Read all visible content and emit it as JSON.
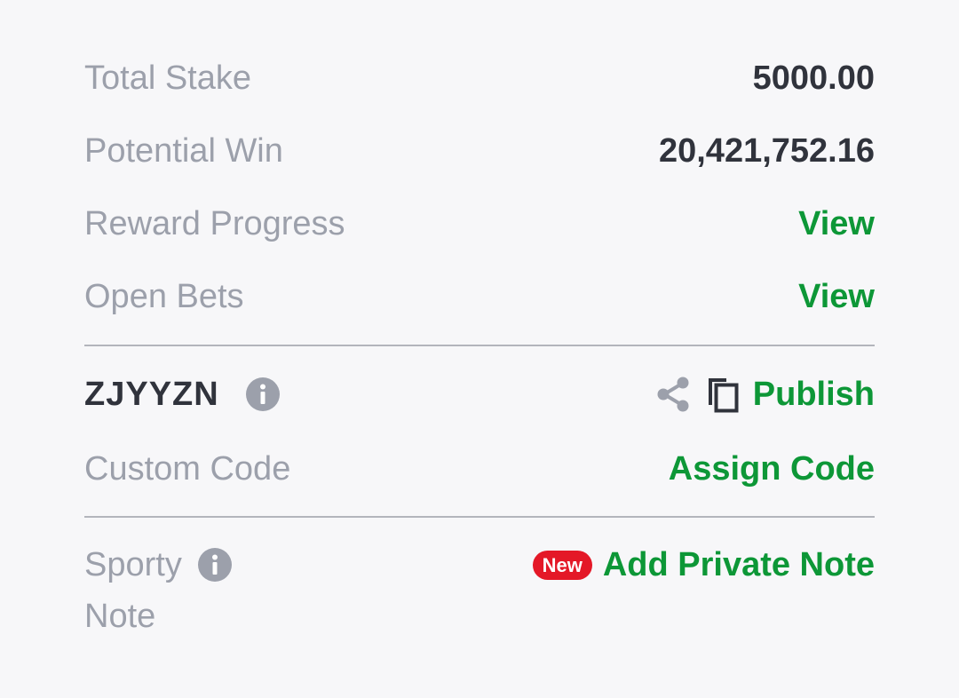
{
  "summary": {
    "total_stake_label": "Total Stake",
    "total_stake_value": "5000.00",
    "potential_win_label": "Potential Win",
    "potential_win_value": "20,421,752.16",
    "reward_progress_label": "Reward Progress",
    "reward_progress_link": "View",
    "open_bets_label": "Open Bets",
    "open_bets_link": "View"
  },
  "booking": {
    "code": "ZJYYZN",
    "info_icon": "info-icon",
    "share_icon": "share-icon",
    "copy_icon": "copy-icon",
    "publish_label": "Publish",
    "custom_code_label": "Custom Code",
    "assign_code_label": "Assign Code"
  },
  "note": {
    "label_line1": "Sporty",
    "label_line2": "Note",
    "info_icon": "info-icon",
    "new_badge": "New",
    "add_note_label": "Add Private Note"
  },
  "colors": {
    "accent_green": "#0d9737",
    "badge_red": "#e41827",
    "label_gray": "#9ca0ab",
    "value_dark": "#30333c",
    "background": "#f7f7f9"
  }
}
